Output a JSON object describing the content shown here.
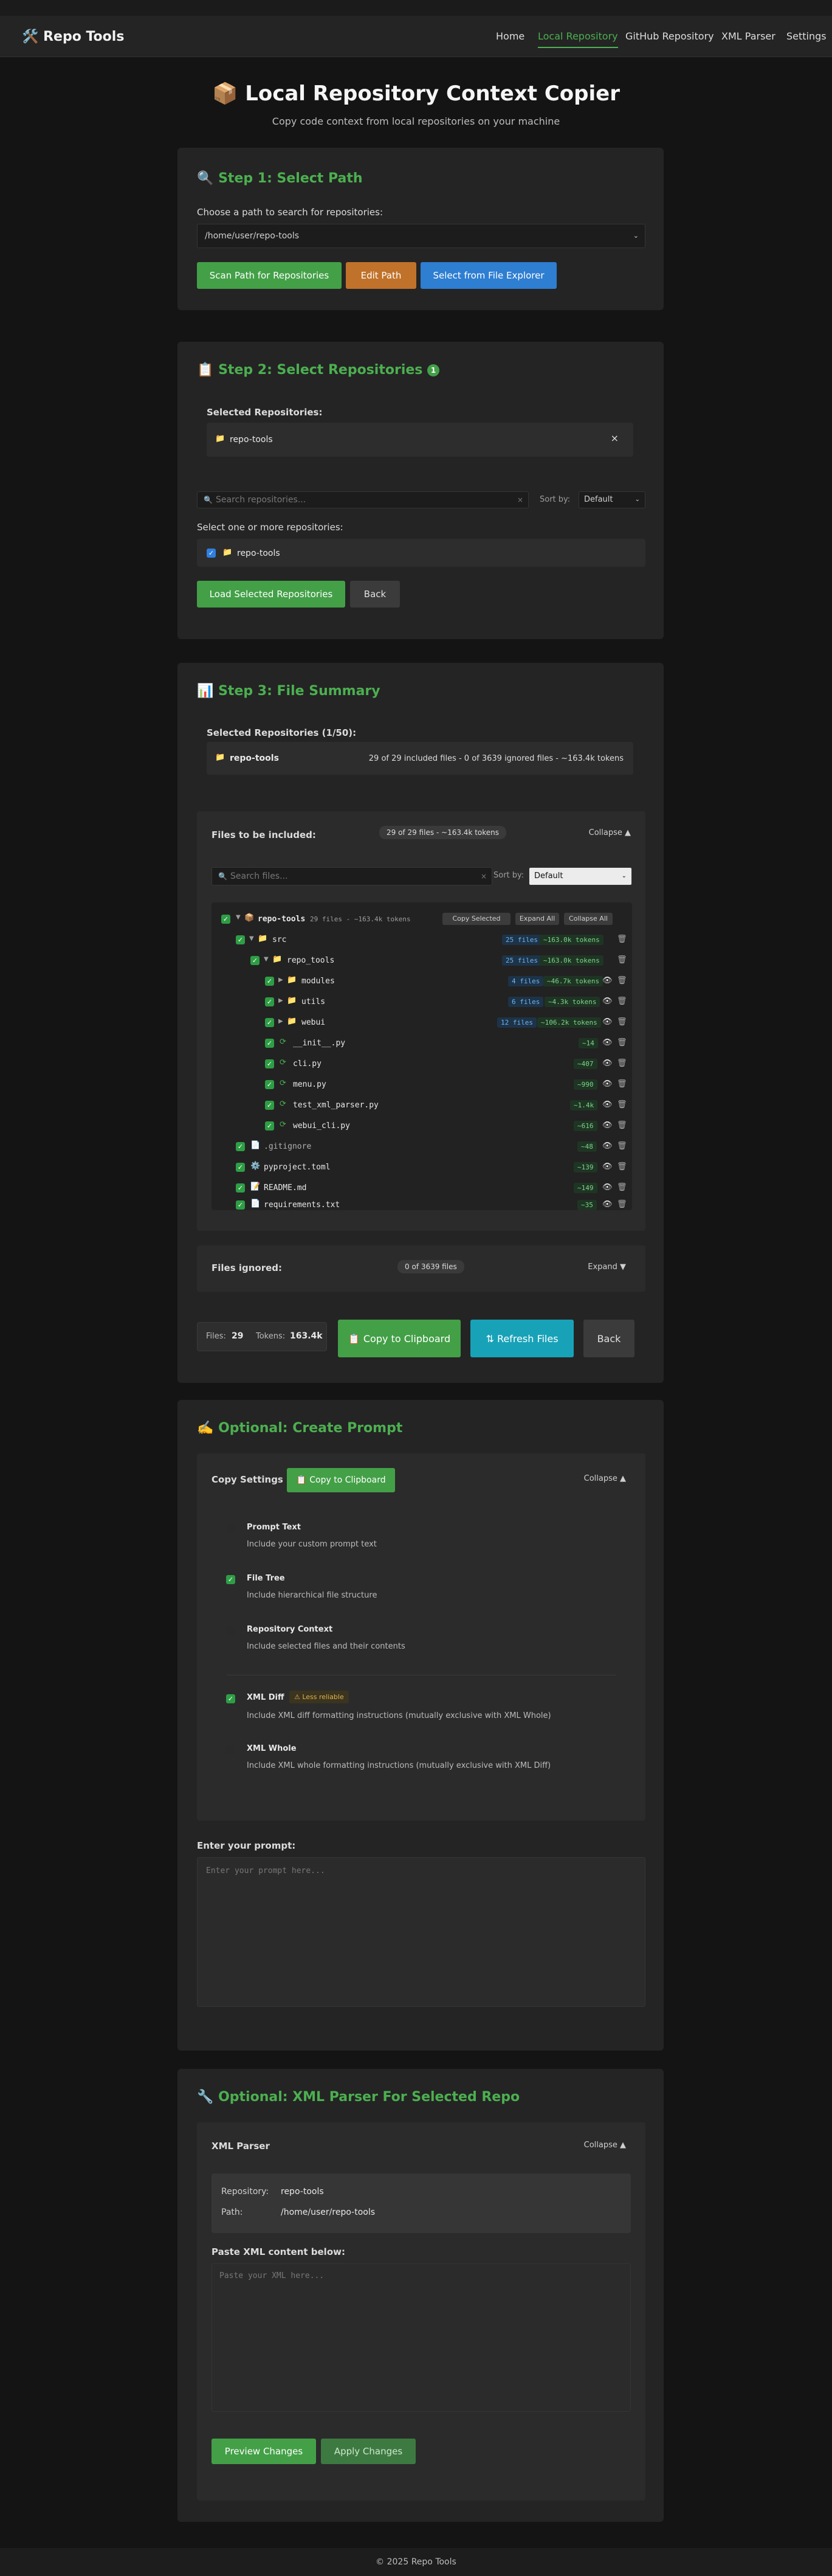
{
  "nav": {
    "brand": "Repo Tools",
    "links": [
      "Home",
      "Local Repository",
      "GitHub Repository",
      "XML Parser",
      "Settings"
    ]
  },
  "header": {
    "title": "Local Repository Context Copier",
    "subtitle": "Copy code context from local repositories on your machine"
  },
  "step1": {
    "title": "Step 1: Select Path",
    "path_label": "Choose a path to search for repositories:",
    "path_value": "/home/user/repo-tools",
    "scan_button": "Scan Path for Repositories",
    "edit_button": "Edit Path",
    "explorer_button": "Select from File Explorer"
  },
  "step2": {
    "title": "Step 2: Select Repositories",
    "count_badge": "1",
    "selected_label": "Selected Repositories:",
    "selected_repo": "repo-tools",
    "search_placeholder": "Search repositories...",
    "sort_label": "Sort by:",
    "sort_value": "Default",
    "select_label": "Select one or more repositories:",
    "repo_option": "repo-tools",
    "load_button": "Load Selected Repositories",
    "back_button": "Back"
  },
  "step3": {
    "title": "Step 3: File Summary",
    "selected_label": "Selected Repositories (1/50):",
    "repo_name": "repo-tools",
    "repo_stats": "29 of 29 included files - 0 of 3639 ignored files - ~163.4k tokens",
    "included_title": "Files to be included:",
    "included_stats": "29 of 29 files - ~163.4k tokens",
    "collapse": "Collapse ▲",
    "search_placeholder": "Search files...",
    "sort_label": "Sort by:",
    "sort_value": "Default",
    "tree_root": {
      "name": "repo-tools",
      "meta": "29 files - ~163.4k tokens",
      "copy": "Copy Selected",
      "expand": "Expand All",
      "collapse": "Collapse All"
    },
    "tree": [
      {
        "name": "src",
        "files": "25 files",
        "tokens": "~163.0k tokens"
      },
      {
        "name": "repo_tools",
        "files": "25 files",
        "tokens": "~163.0k tokens"
      },
      {
        "name": "modules",
        "files": "4 files",
        "tokens": "~46.7k tokens"
      },
      {
        "name": "utils",
        "files": "6 files",
        "tokens": "~4.3k tokens"
      },
      {
        "name": "webui",
        "files": "12 files",
        "tokens": "~106.2k tokens"
      },
      {
        "name": "__init__.py",
        "tokens": "~14"
      },
      {
        "name": "cli.py",
        "tokens": "~407"
      },
      {
        "name": "menu.py",
        "tokens": "~990"
      },
      {
        "name": "test_xml_parser.py",
        "tokens": "~1.4k"
      },
      {
        "name": "webui_cli.py",
        "tokens": "~616"
      },
      {
        "name": ".gitignore",
        "tokens": "~48"
      },
      {
        "name": "pyproject.toml",
        "tokens": "~139"
      },
      {
        "name": "README.md",
        "tokens": "~149"
      },
      {
        "name": "requirements.txt",
        "tokens": "~35"
      }
    ],
    "ignored_title": "Files ignored:",
    "ignored_stats": "0 of 3639 files",
    "expand": "Expand ▼",
    "summary_files_label": "Files:",
    "summary_files": "29",
    "summary_tokens_label": "Tokens:",
    "summary_tokens": "163.4k",
    "copy_button": "Copy to Clipboard",
    "refresh_button": "Refresh Files",
    "back_button": "Back"
  },
  "prompt": {
    "title": "Optional: Create Prompt",
    "copy_settings": "Copy Settings",
    "copy_button": "Copy to Clipboard",
    "collapse": "Collapse ▲",
    "options": [
      {
        "title": "Prompt Text",
        "desc": "Include your custom prompt text"
      },
      {
        "title": "File Tree",
        "desc": "Include hierarchical file structure"
      },
      {
        "title": "Repository Context",
        "desc": "Include selected files and their contents"
      },
      {
        "title": "XML Diff",
        "desc": "Include XML diff formatting instructions (mutually exclusive with XML Whole)",
        "badge": "⚠ Less reliable"
      },
      {
        "title": "XML Whole",
        "desc": "Include XML whole formatting instructions (mutually exclusive with XML Diff)"
      }
    ],
    "enter_label": "Enter your prompt:",
    "placeholder": "Enter your prompt here..."
  },
  "xml": {
    "title": "Optional: XML Parser For Selected Repo",
    "parser_title": "XML Parser",
    "collapse": "Collapse ▲",
    "repo_label": "Repository:",
    "repo_value": "repo-tools",
    "path_label": "Path:",
    "path_value": "/home/user/repo-tools",
    "paste_label": "Paste XML content below:",
    "placeholder": "Paste your XML here...",
    "preview_button": "Preview Changes",
    "apply_button": "Apply Changes"
  },
  "footer": "© 2025 Repo Tools"
}
